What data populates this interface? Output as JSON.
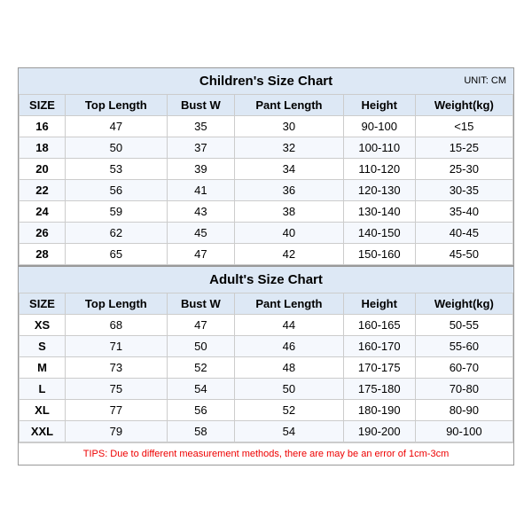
{
  "children": {
    "title": "Children's Size Chart",
    "unit": "UNIT: CM",
    "headers": [
      "SIZE",
      "Top Length",
      "Bust W",
      "Pant Length",
      "Height",
      "Weight(kg)"
    ],
    "rows": [
      [
        "16",
        "47",
        "35",
        "30",
        "90-100",
        "<15"
      ],
      [
        "18",
        "50",
        "37",
        "32",
        "100-110",
        "15-25"
      ],
      [
        "20",
        "53",
        "39",
        "34",
        "110-120",
        "25-30"
      ],
      [
        "22",
        "56",
        "41",
        "36",
        "120-130",
        "30-35"
      ],
      [
        "24",
        "59",
        "43",
        "38",
        "130-140",
        "35-40"
      ],
      [
        "26",
        "62",
        "45",
        "40",
        "140-150",
        "40-45"
      ],
      [
        "28",
        "65",
        "47",
        "42",
        "150-160",
        "45-50"
      ]
    ]
  },
  "adult": {
    "title": "Adult's Size Chart",
    "headers": [
      "SIZE",
      "Top Length",
      "Bust W",
      "Pant Length",
      "Height",
      "Weight(kg)"
    ],
    "rows": [
      [
        "XS",
        "68",
        "47",
        "44",
        "160-165",
        "50-55"
      ],
      [
        "S",
        "71",
        "50",
        "46",
        "160-170",
        "55-60"
      ],
      [
        "M",
        "73",
        "52",
        "48",
        "170-175",
        "60-70"
      ],
      [
        "L",
        "75",
        "54",
        "50",
        "175-180",
        "70-80"
      ],
      [
        "XL",
        "77",
        "56",
        "52",
        "180-190",
        "80-90"
      ],
      [
        "XXL",
        "79",
        "58",
        "54",
        "190-200",
        "90-100"
      ]
    ]
  },
  "tips": "TIPS: Due to different measurement methods, there are may be an error of 1cm-3cm"
}
